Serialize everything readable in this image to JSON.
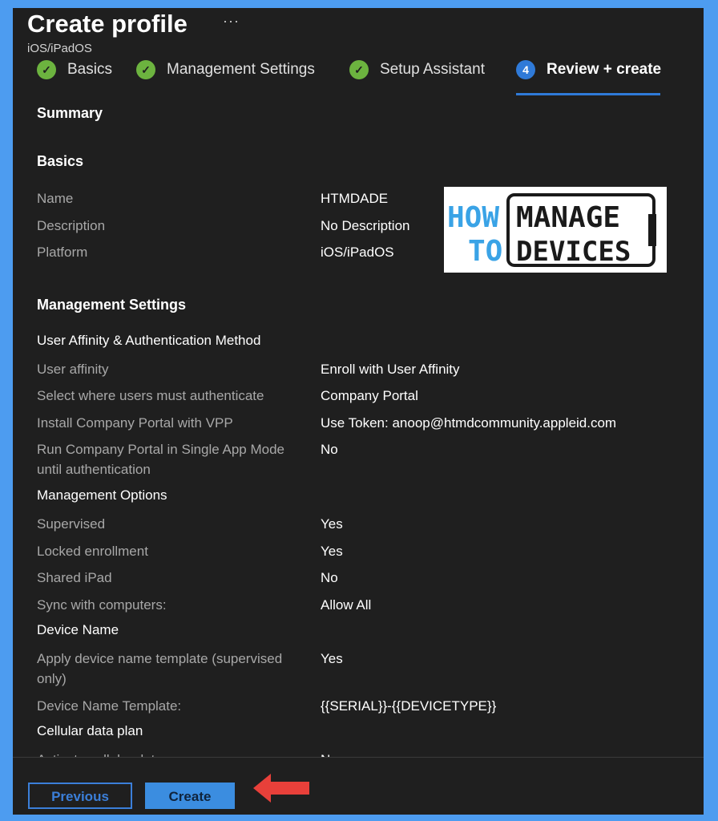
{
  "header": {
    "title": "Create profile",
    "more_label": "···",
    "subtitle": "iOS/iPadOS"
  },
  "steps": [
    {
      "label": "Basics",
      "state": "done",
      "icon": "check-icon"
    },
    {
      "label": "Management Settings",
      "state": "done",
      "icon": "check-icon"
    },
    {
      "label": "Setup Assistant",
      "state": "done",
      "icon": "check-icon"
    },
    {
      "label": "Review + create",
      "state": "current",
      "number": "4"
    }
  ],
  "summary": {
    "heading": "Summary",
    "basics_heading": "Basics",
    "basics": [
      {
        "label": "Name",
        "value": "HTMDADE"
      },
      {
        "label": "Description",
        "value": "No Description"
      },
      {
        "label": "Platform",
        "value": "iOS/iPadOS"
      }
    ],
    "mgmt_heading": "Management Settings",
    "ua_heading": "User Affinity & Authentication Method",
    "ua": [
      {
        "label": "User affinity",
        "value": "Enroll with User Affinity"
      },
      {
        "label": "Select where users must authenticate",
        "value": "Company Portal"
      },
      {
        "label": "Install Company Portal with VPP",
        "value": "Use Token: anoop@htmdcommunity.appleid.com"
      },
      {
        "label": "Run Company Portal in Single App Mode until authentication",
        "value": "No"
      }
    ],
    "mo_heading": "Management Options",
    "mo": [
      {
        "label": "Supervised",
        "value": "Yes"
      },
      {
        "label": "Locked enrollment",
        "value": "Yes"
      },
      {
        "label": "Shared iPad",
        "value": "No"
      },
      {
        "label": "Sync with computers:",
        "value": "Allow All"
      }
    ],
    "dn_heading": "Device Name",
    "dn": [
      {
        "label": "Apply device name template (supervised only)",
        "value": "Yes"
      },
      {
        "label": "Device Name Template:",
        "value": "{{SERIAL}}-{{DEVICETYPE}}"
      }
    ],
    "cell_heading": "Cellular data plan",
    "cell": [
      {
        "label": "Activate cellular data",
        "value": "No"
      }
    ]
  },
  "logo": {
    "how": "HOW",
    "to": "TO",
    "manage": "MANAGE",
    "devices": "DEVICES",
    "color_blue": "#3aa3e6",
    "color_dark": "#1a1a1a"
  },
  "footer": {
    "previous_label": "Previous",
    "create_label": "Create",
    "arrow_color": "#e8403a"
  }
}
